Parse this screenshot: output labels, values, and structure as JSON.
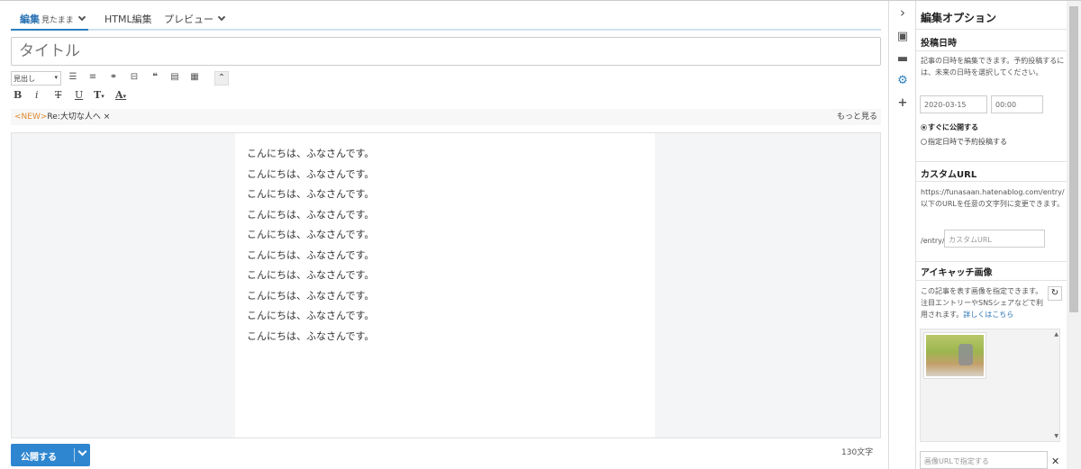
{
  "tabs": {
    "edit_label": "編集",
    "edit_mode": "見たまま",
    "html_label": "HTML編集",
    "preview_label": "プレビュー"
  },
  "title": {
    "placeholder": "タイトル"
  },
  "toolbar": {
    "heading_select": "見出し",
    "bold": "B",
    "italic": "i",
    "strike": "T",
    "underline": "U",
    "font_size": "T",
    "text_color": "A"
  },
  "related": {
    "new_tag": "<NEW>",
    "entry_title": "Re:大切な人へ",
    "more": "もっと見る"
  },
  "body_lines": [
    "こんにちは、ふなさんです。",
    "こんにちは、ふなさんです。",
    "こんにちは、ふなさんです。",
    "こんにちは、ふなさんです。",
    "こんにちは、ふなさんです。",
    "こんにちは、ふなさんです。",
    "こんにちは、ふなさんです。",
    "こんにちは、ふなさんです。",
    "こんにちは、ふなさんです。",
    "こんにちは、ふなさんです。"
  ],
  "footer": {
    "publish_label": "公開する",
    "char_count": "130文字"
  },
  "panel": {
    "title": "編集オプション",
    "date_section": {
      "title": "投稿日時",
      "description": "記事の日時を編集できます。予約投稿するには、未来の日時を選択してください。",
      "date": "2020-03-15",
      "time": "00:00",
      "option_now": "すぐに公開する",
      "option_schedule": "指定日時で予約投稿する"
    },
    "url_section": {
      "title": "カスタムURL",
      "description": "https://funasaan.hatenablog.com/entry/以下のURLを任意の文字列に変更できます。",
      "prefix": "/entry/",
      "placeholder": "カスタムURL"
    },
    "eyecatch_section": {
      "title": "アイキャッチ画像",
      "description": "この記事を表す画像を指定できます。注目エントリーやSNSシェアなどで利用されます。",
      "link": "詳しくはこちら",
      "url_placeholder": "画像URLで指定する"
    }
  },
  "colors": {
    "accent": "#2f86d0",
    "new_tag": "#e08a2e"
  }
}
